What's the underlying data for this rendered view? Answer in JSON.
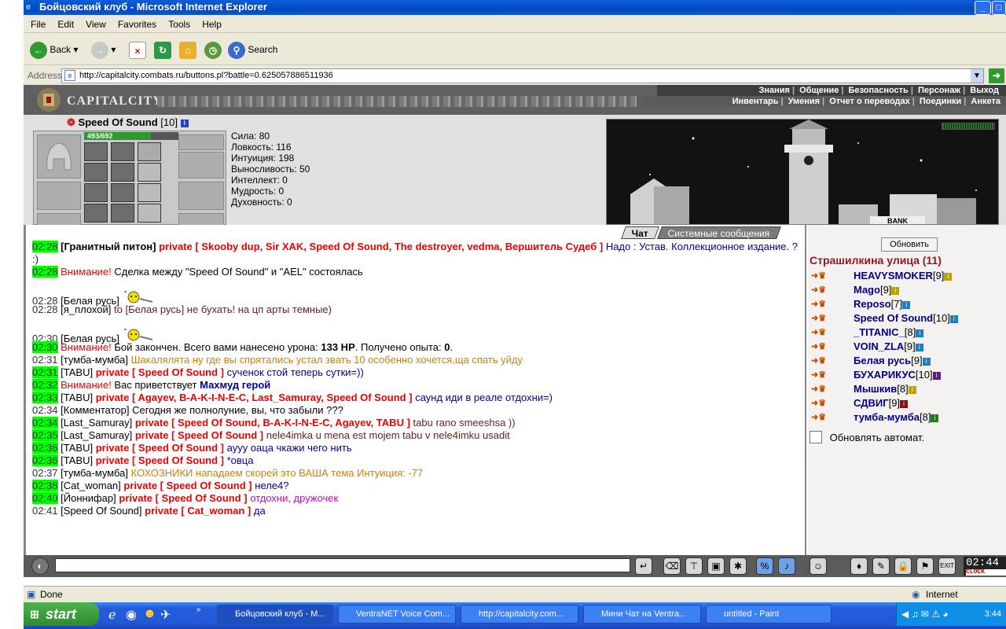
{
  "window": {
    "title": "Бойцовский клуб - Microsoft Internet Explorer"
  },
  "menu": [
    "File",
    "Edit",
    "View",
    "Favorites",
    "Tools",
    "Help"
  ],
  "toolbar": {
    "back": "Back",
    "search": "Search"
  },
  "address": {
    "label": "Address",
    "url": "http://capitalcity.combats.ru/buttons.pl?battle=0.625057886511936"
  },
  "site": {
    "logo": "CAPITALCITY",
    "menu_top": [
      "Знания",
      "Общение",
      "Безопасность",
      "Персонаж",
      "Выход"
    ],
    "menu_bottom": [
      "Инвентарь",
      "Умения",
      "Отчет о переводах",
      "Поединки",
      "Анкета"
    ]
  },
  "character": {
    "name": "Speed Of Sound",
    "level": "[10]",
    "hp": "493/692",
    "hp_fraction": 0.712,
    "stats": [
      "Сила: 80",
      "Ловкость: 116",
      "Интуиция: 198",
      "Выносливость: 50",
      "Интеллект: 0",
      "Мудрость: 0",
      "Духовность: 0"
    ],
    "bank_label": "BANK"
  },
  "chat": {
    "tabs": [
      "Чат",
      "Системные сообщения"
    ],
    "messages": [
      {
        "time": "02:28",
        "hl": true,
        "nick": "[Гранитный питон]",
        "nick_bold": true,
        "priv": "private [ Skooby dup, Sir XAK, Speed Of Sound, The destroyer, vedma, Вершитель Судеб ]",
        "text": "Надо : Устав. Коллекционное издание. ? :)",
        "color": "blue",
        "wrap": true
      },
      {
        "time": "02:28",
        "hl": true,
        "warn": "Внимание!",
        "text": "Сделка между \"Speed Of Sound\" и \"AEL\" состоялась",
        "color": "black"
      },
      {
        "time": "02:28",
        "hl": false,
        "nick": "[Белая русь]",
        "text": "",
        "smile": true
      },
      {
        "time": "02:28",
        "hl": false,
        "nick": "[я_плохой]",
        "text": "to [Белая русь] не бухать! на цп арты темные)",
        "color": "maroon"
      },
      {
        "time": "02:30",
        "hl": false,
        "nick": "[Белая русь]",
        "text": "",
        "smile": true
      },
      {
        "time": "02:30",
        "hl": true,
        "warn": "Внимание!",
        "text": "Бой закончен. Всего вами нанесено урона:",
        "b1": "133 HP",
        "text2": ". Получено опыта:",
        "b2": "0",
        "text3": ".",
        "color": "black"
      },
      {
        "time": "02:31",
        "hl": false,
        "nick": "[тумба-мумба]",
        "text": "Шакалялята ну где вы спрятались устал звать 10 особенно хочется,ща спать уйду",
        "color": "orange"
      },
      {
        "time": "02:31",
        "hl": true,
        "nick": "[TABU]",
        "priv": "private [ Speed Of Sound ]",
        "text": "сученок стой теперь сутки=))",
        "color": "blue"
      },
      {
        "time": "02:32",
        "hl": true,
        "warn": "Внимание!",
        "text": "Вас приветствует",
        "blue_bold": "Махмуд герой",
        "color": "black"
      },
      {
        "time": "02:33",
        "hl": true,
        "nick": "[TABU]",
        "priv": "private [ Agayev, B-A-K-I-N-E-C, Last_Samuray, Speed Of Sound ]",
        "text": "саунд иди в реале отдохни=)",
        "color": "blue"
      },
      {
        "time": "02:34",
        "hl": false,
        "nick": "[Комментатор]",
        "text": "Сегодня же полнолуние, вы, что забыли ???",
        "color": "black"
      },
      {
        "time": "02:34",
        "hl": true,
        "nick": "[Last_Samuray]",
        "priv": "private [ Speed Of Sound, B-A-K-I-N-E-C, Agayev, TABU ]",
        "text": "tabu rano smeeshsa ))",
        "color": "maroon"
      },
      {
        "time": "02:35",
        "hl": true,
        "nick": "[Last_Samuray]",
        "priv": "private [ Speed Of Sound ]",
        "text": "nele4imka u mena est mojem tabu v nele4imku usadit",
        "color": "maroon"
      },
      {
        "time": "02:36",
        "hl": true,
        "nick": "[TABU]",
        "priv": "private [ Speed Of Sound ]",
        "text": "ауyy оаца чкажи чего нить",
        "color": "blue"
      },
      {
        "time": "02:36",
        "hl": true,
        "nick": "[TABU]",
        "priv": "private [ Speed Of Sound ]",
        "text": "*овца",
        "color": "blue"
      },
      {
        "time": "02:37",
        "hl": false,
        "nick": "[тумба-мумба]",
        "text": "КОХОЗНИКИ нападаем скорей это ВАША тема Интуиция: -77",
        "color": "orange"
      },
      {
        "time": "02:38",
        "hl": true,
        "nick": "[Cat_woman]",
        "priv": "private [ Speed Of Sound ]",
        "text": "неле4?",
        "color": "blue"
      },
      {
        "time": "02:40",
        "hl": true,
        "nick": "[Йоннифар]",
        "priv": "private [ Speed Of Sound ]",
        "text": "отдохни, дружочек",
        "color": "magenta"
      },
      {
        "time": "02:41",
        "hl": false,
        "nick": "[Speed Of Sound]",
        "priv": "private [ Cat_woman ]",
        "text": "да",
        "color": "blue"
      }
    ]
  },
  "online": {
    "refresh": "Обновить",
    "location": "Страшилкина улица (11)",
    "users": [
      {
        "name": "HEAVYSMOKER",
        "level": "[9]",
        "info": "y"
      },
      {
        "name": "Mago",
        "level": "[9]",
        "info": "y"
      },
      {
        "name": "Reposo",
        "level": "[7]",
        "info": "b"
      },
      {
        "name": "Speed Of Sound",
        "level": "[10]",
        "info": "b"
      },
      {
        "name": "_TITANIC_",
        "level": "[8]",
        "info": "b"
      },
      {
        "name": "VOIN_ZLA",
        "level": "[9]",
        "info": "b"
      },
      {
        "name": "Белая русь",
        "level": "[9]",
        "info": "b"
      },
      {
        "name": "БУХАРИКУС",
        "level": "[10]",
        "info": "p"
      },
      {
        "name": "Мышкив",
        "level": "[8]",
        "info": "y"
      },
      {
        "name": "СДВИГ",
        "level": "[9]",
        "info": "r"
      },
      {
        "name": "тумба-мумба",
        "level": "[8]",
        "info": "g"
      }
    ],
    "auto": "Обновлять автомат."
  },
  "clock": {
    "time": "02:44",
    "label": "CLOCK"
  },
  "status": {
    "done": "Done",
    "zone": "Internet"
  },
  "taskbar": {
    "start": "start",
    "tasks": [
      "Бойцовский клуб - M...",
      "VentraNET Voice Com...",
      "http://capitalcity.com...",
      "Мини Чат на Ventra...",
      "untitled - Paint"
    ],
    "time": "3:44"
  }
}
